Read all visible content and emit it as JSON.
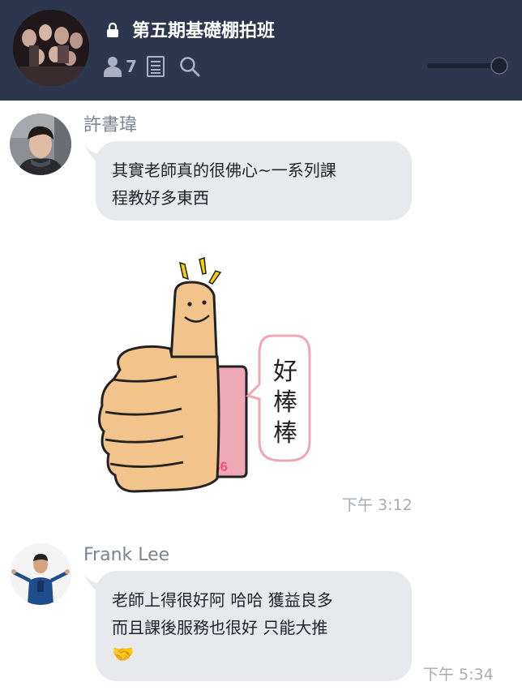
{
  "header": {
    "title": "第五期基礎棚拍班",
    "member_count": "7",
    "icons": [
      "lock-icon",
      "member-icon",
      "notes-icon",
      "search-icon"
    ]
  },
  "messages": [
    {
      "sender": "許書瑋",
      "lines": [
        "其實老師真的很佛心~一系列課",
        "程教好多東西"
      ]
    },
    {
      "sticker": {
        "caption_chars": [
          "好",
          "棒",
          "棒"
        ],
        "badge": "86"
      },
      "time": "下午 3:12"
    },
    {
      "sender": "Frank Lee",
      "lines": [
        "老師上得很好阿 哈哈 獲益良多",
        "而且課後服務也很好 只能大推"
      ],
      "emoji": "🤝",
      "time": "下午 5:34"
    }
  ],
  "colors": {
    "header_bg": "#2c374d",
    "bubble_bg": "#e7e9ec",
    "secondary_text": "#7b8391",
    "timestamp": "#a5abb4"
  }
}
